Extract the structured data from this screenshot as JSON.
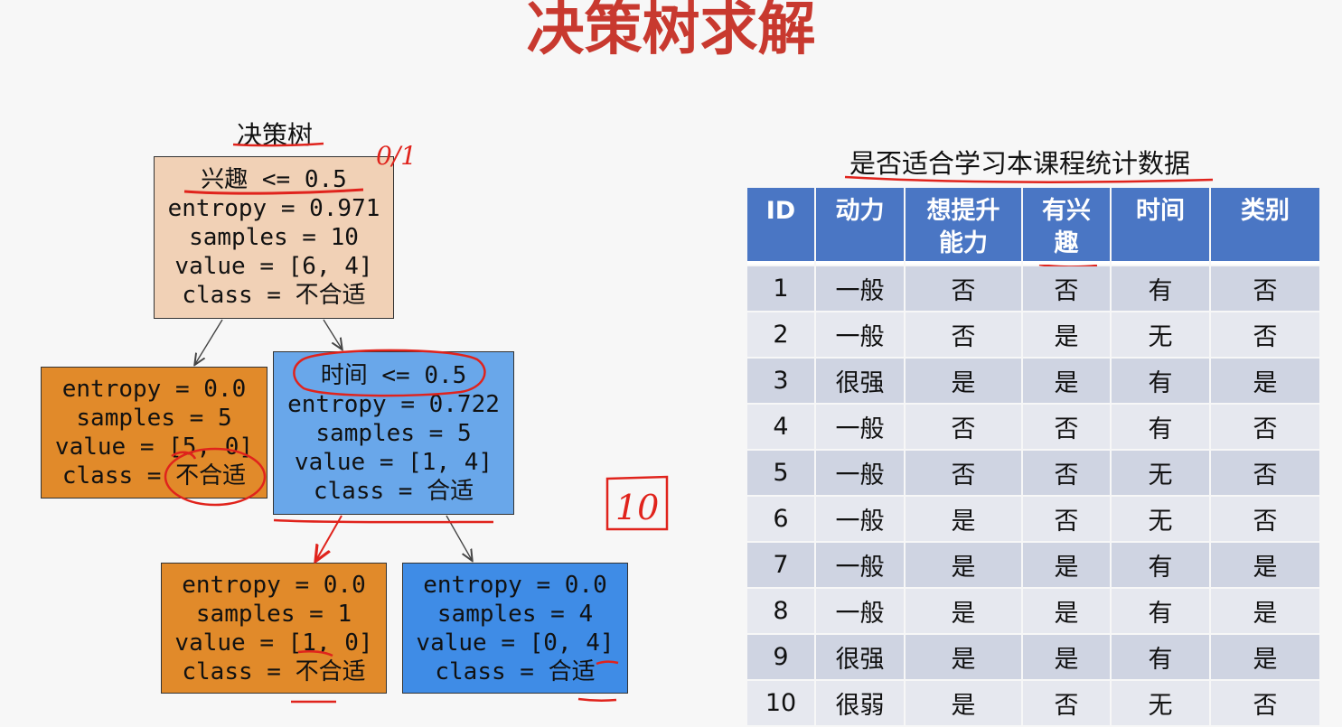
{
  "title": "决策树求解",
  "tree": {
    "caption": "决策树",
    "nodes": {
      "root": [
        "兴趣 <= 0.5",
        "entropy = 0.971",
        "samples = 10",
        "value = [6, 4]",
        "class = 不合适"
      ],
      "left": [
        "entropy = 0.0",
        "samples = 5",
        "value = [5, 0]",
        "class = 不合适"
      ],
      "right": [
        "时间 <= 0.5",
        "entropy = 0.722",
        "samples = 5",
        "value = [1, 4]",
        "class = 合适"
      ],
      "right_left": [
        "entropy = 0.0",
        "samples = 1",
        "value = [1, 0]",
        "class = 不合适"
      ],
      "right_right": [
        "entropy = 0.0",
        "samples = 4",
        "value = [0, 4]",
        "class = 合适"
      ]
    },
    "annotations": {
      "ratio": "0/1",
      "count": "10"
    },
    "colors": {
      "root_fill": "#f1d1b6",
      "orange_leaf": "#e18a2a",
      "blue_inner": "#69a7ea",
      "blue_leaf": "#3f8ce6",
      "ink_red": "#e0231c"
    }
  },
  "table": {
    "caption": "是否适合学习本课程统计数据",
    "headers": [
      "ID",
      "动力",
      "想提升能力",
      "有兴趣",
      "时间",
      "类别"
    ],
    "rows": [
      [
        "1",
        "一般",
        "否",
        "否",
        "有",
        "否"
      ],
      [
        "2",
        "一般",
        "否",
        "是",
        "无",
        "否"
      ],
      [
        "3",
        "很强",
        "是",
        "是",
        "有",
        "是"
      ],
      [
        "4",
        "一般",
        "否",
        "否",
        "有",
        "否"
      ],
      [
        "5",
        "一般",
        "否",
        "否",
        "无",
        "否"
      ],
      [
        "6",
        "一般",
        "是",
        "否",
        "无",
        "否"
      ],
      [
        "7",
        "一般",
        "是",
        "是",
        "有",
        "是"
      ],
      [
        "8",
        "一般",
        "是",
        "是",
        "有",
        "是"
      ],
      [
        "9",
        "很强",
        "是",
        "是",
        "有",
        "是"
      ],
      [
        "10",
        "很弱",
        "是",
        "否",
        "无",
        "否"
      ]
    ],
    "colors": {
      "header_bg": "#4a76c4",
      "row_odd": "#cfd4e2",
      "row_even": "#e6e8ef",
      "positive_class": "#e23b2d"
    }
  }
}
